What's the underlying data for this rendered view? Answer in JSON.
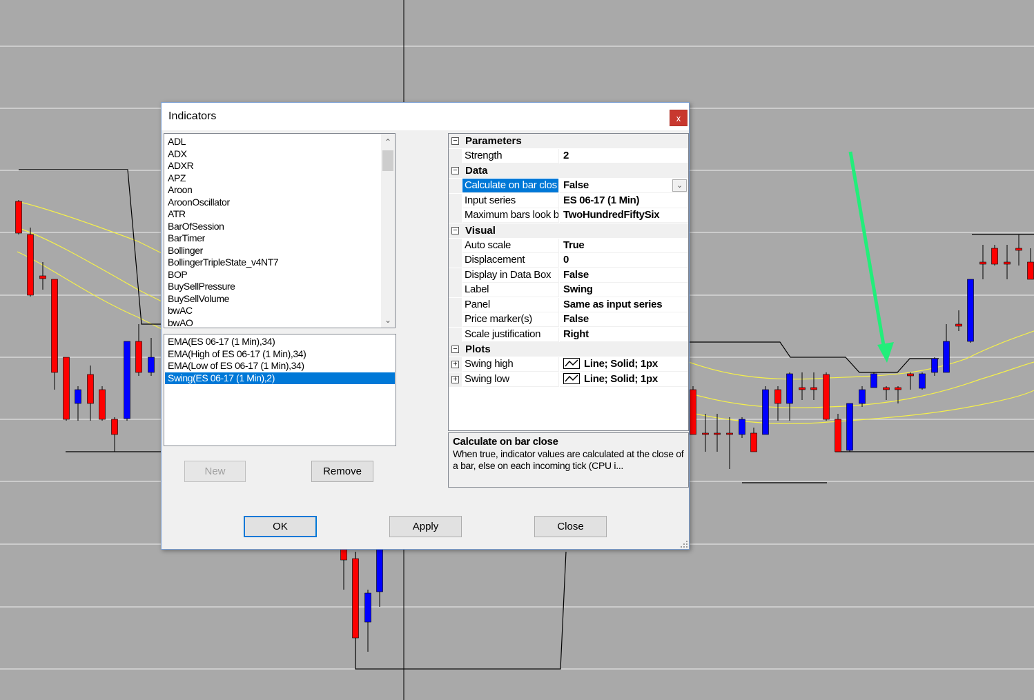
{
  "dialog": {
    "title": "Indicators",
    "close_glyph": "x"
  },
  "indicator_list": {
    "items": [
      "ADL",
      "ADX",
      "ADXR",
      "APZ",
      "Aroon",
      "AroonOscillator",
      "ATR",
      "BarOfSession",
      "BarTimer",
      "Bollinger",
      "BollingerTripleState_v4NT7",
      "BOP",
      "BuySellPressure",
      "BuySellVolume",
      "bwAC",
      "bwAO"
    ]
  },
  "applied_list": {
    "items": [
      "EMA(ES 06-17 (1 Min),34)",
      "EMA(High of ES 06-17 (1 Min),34)",
      "EMA(Low of ES 06-17 (1 Min),34)",
      "Swing(ES 06-17 (1 Min),2)"
    ],
    "selected_index": 3
  },
  "buttons": {
    "new": "New",
    "remove": "Remove",
    "ok": "OK",
    "apply": "Apply",
    "close": "Close"
  },
  "properties": {
    "categories": {
      "parameters": "Parameters",
      "data": "Data",
      "visual": "Visual",
      "plots": "Plots"
    },
    "parameters": [
      {
        "name": "Strength",
        "value": "2"
      }
    ],
    "data": [
      {
        "name": "Calculate on bar clos",
        "value": "False"
      },
      {
        "name": "Input series",
        "value": "ES 06-17 (1 Min)"
      },
      {
        "name": "Maximum bars look b",
        "value": "TwoHundredFiftySix"
      }
    ],
    "visual": [
      {
        "name": "Auto scale",
        "value": "True"
      },
      {
        "name": "Displacement",
        "value": "0"
      },
      {
        "name": "Display in Data Box",
        "value": "False"
      },
      {
        "name": "Label",
        "value": "Swing"
      },
      {
        "name": "Panel",
        "value": "Same as input series"
      },
      {
        "name": "Price marker(s)",
        "value": "False"
      },
      {
        "name": "Scale justification",
        "value": "Right"
      }
    ],
    "plots": [
      {
        "name": "Swing high",
        "value": "Line; Solid; 1px"
      },
      {
        "name": "Swing low",
        "value": "Line; Solid; 1px"
      }
    ]
  },
  "description": {
    "title": "Calculate on bar close",
    "text": "When true, indicator values are calculated at the close of a bar, else on each incoming tick (CPU i..."
  },
  "colors": {
    "chart_background": "#a9a9a9",
    "up_candle": "#0000ff",
    "down_candle": "#ff0000",
    "ema_line": "#f5f04a",
    "annotation_arrow": "#22ee7a",
    "selection": "#0078d7"
  }
}
